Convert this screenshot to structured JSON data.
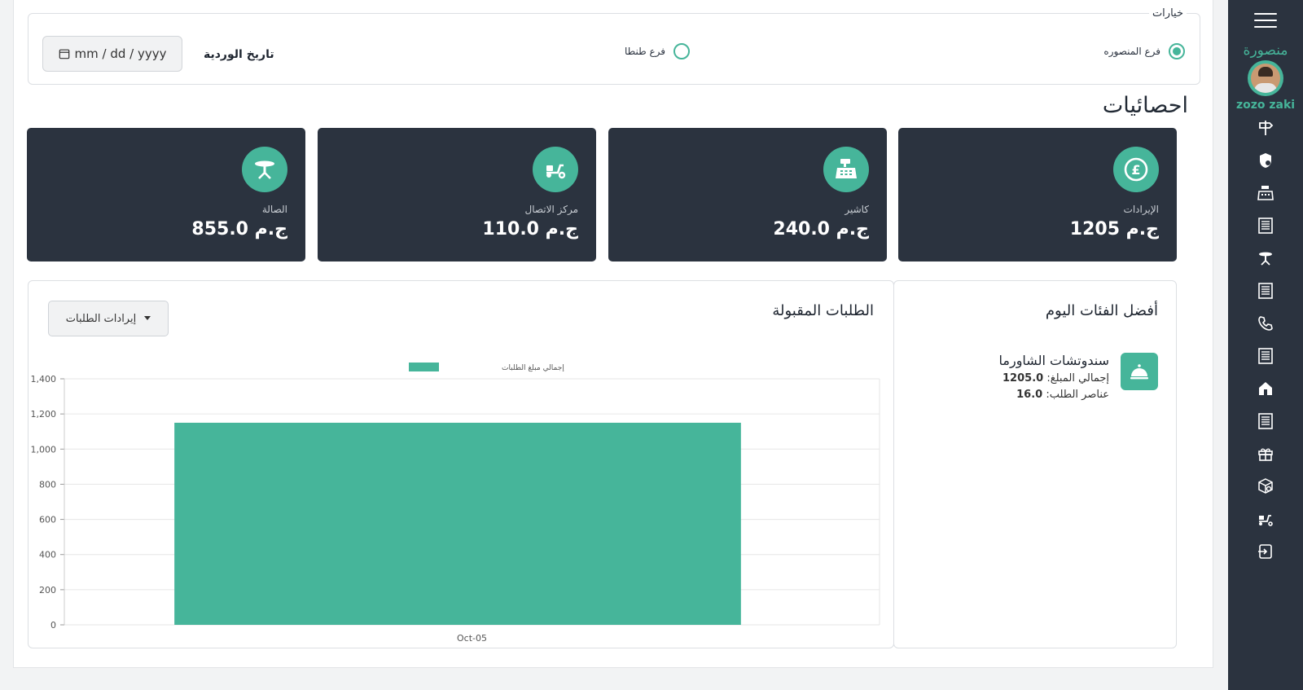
{
  "sidebar": {
    "branch_name": "منصورة",
    "user_name": "zozo zaki",
    "icons": [
      "signpost-icon",
      "shield-lock-icon",
      "cash-register-icon",
      "receipt-icon",
      "table-icon",
      "receipt-icon",
      "phone-icon",
      "receipt-icon",
      "home-shop-icon",
      "receipt-icon",
      "gift-icon",
      "package-search-icon",
      "scooter-icon",
      "logout-icon"
    ]
  },
  "options": {
    "title": "خيارات",
    "branch_mansoura": "فرع المنصوره",
    "branch_tanta": "فرع طنطا",
    "selected": "branch_mansoura",
    "date_label": "تاريخ الوردية",
    "date_placeholder": "mm / dd / yyyy"
  },
  "stats": {
    "title": "احصائيات",
    "cards": [
      {
        "label": "الإيرادات",
        "value": "1205 ج.م",
        "icon": "pound-coin-icon"
      },
      {
        "label": "كاشير",
        "value": "240.0 ج.م",
        "icon": "cash-register-icon"
      },
      {
        "label": "مركز الاتصال",
        "value": "110.0 ج.م",
        "icon": "scooter-icon"
      },
      {
        "label": "الصالة",
        "value": "855.0 ج.م",
        "icon": "table-icon"
      }
    ]
  },
  "top_categories": {
    "title": "أفضل الفئات اليوم",
    "item": {
      "name": "سندوتشات الشاورما",
      "total_label": "إجمالي المبلغ:",
      "total_value": "1205.0",
      "items_label": "عناصر الطلب:",
      "items_value": "16.0",
      "icon": "food-cloche-icon"
    }
  },
  "orders": {
    "title": "الطلبات المقبولة",
    "dropdown_value": "إيرادات الطلبات"
  },
  "chart_data": {
    "type": "bar",
    "categories": [
      "Oct-05"
    ],
    "series": [
      {
        "name": "إجمالي مبلغ الطلبات",
        "values": [
          1150
        ],
        "color": "#46b59a"
      }
    ],
    "ylim": [
      0,
      1400
    ],
    "yticks": [
      "0",
      "200",
      "400",
      "600",
      "800",
      "1,000",
      "1,200",
      "1,400"
    ],
    "grid": true,
    "legend": "top-center"
  },
  "colors": {
    "accent": "#46b59a",
    "dark": "#2b333f"
  }
}
